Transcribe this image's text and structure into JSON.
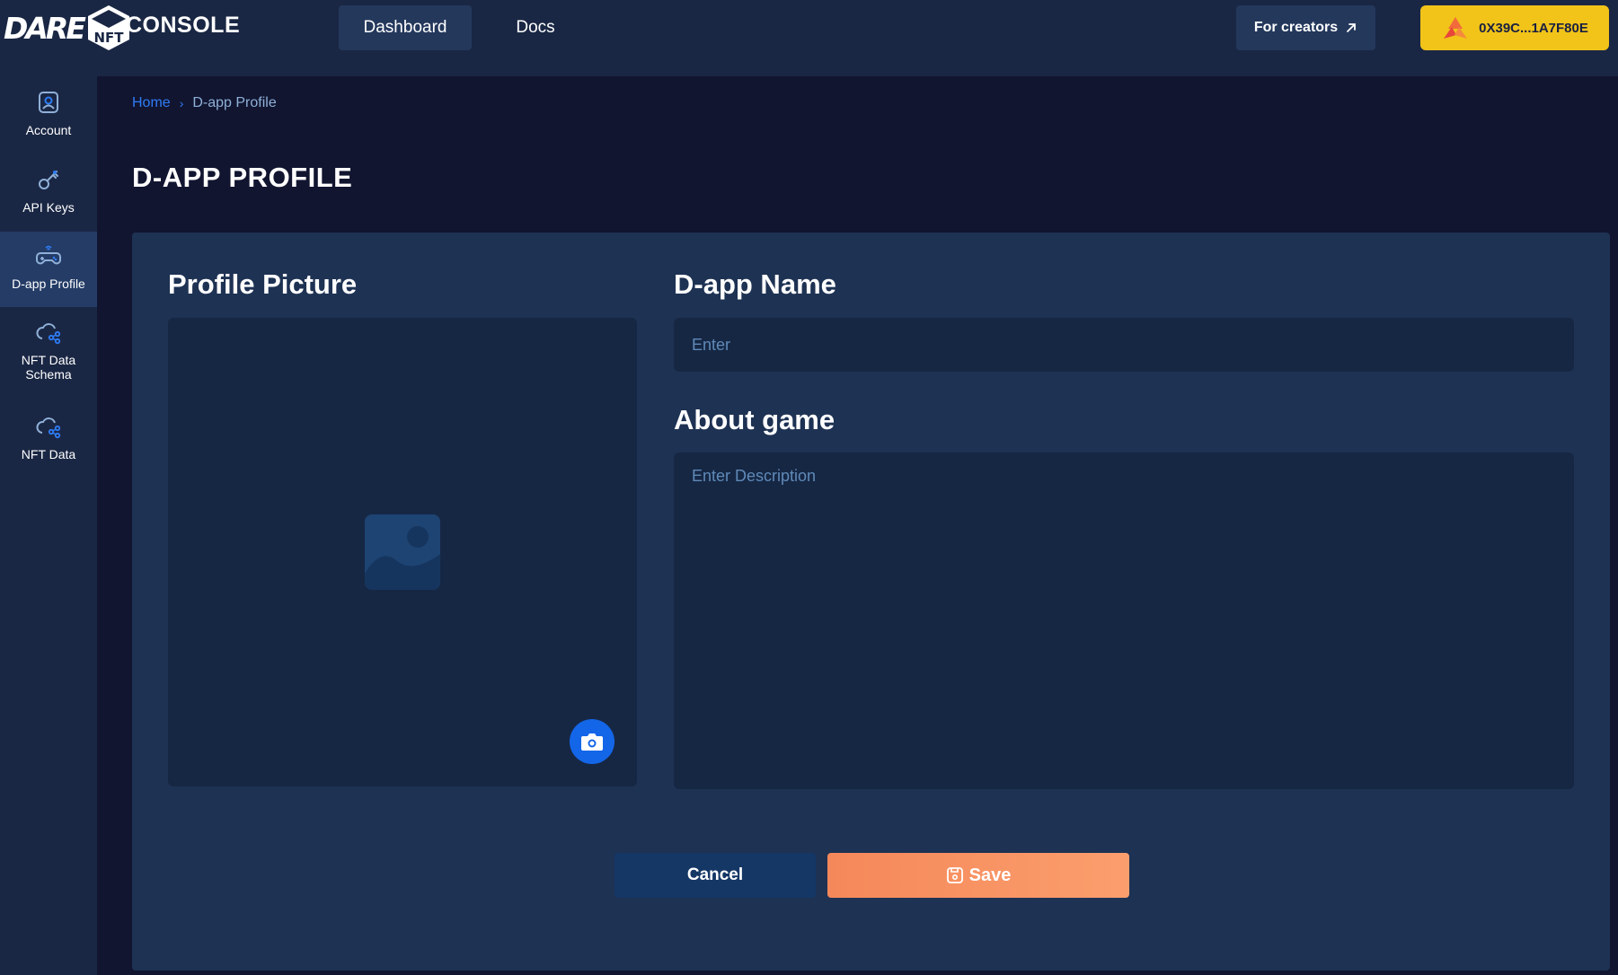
{
  "header": {
    "logo_text": "DARE",
    "logo_cube_text": "NFT",
    "console_title": "CONSOLE",
    "nav": [
      {
        "label": "Dashboard",
        "active": true
      },
      {
        "label": "Docs",
        "active": false
      }
    ],
    "creators_label": "For creators",
    "creators_icon": "external-link-arrow-icon",
    "wallet_address": "0X39C...1A7F80E",
    "wallet_icon": "wallet-logo-icon"
  },
  "sidebar": {
    "items": [
      {
        "label": "Account",
        "icon": "account-icon",
        "active": false
      },
      {
        "label": "API Keys",
        "icon": "key-icon",
        "active": false
      },
      {
        "label": "D-app Profile",
        "icon": "gamepad-icon",
        "active": true
      },
      {
        "label": "NFT Data Schema",
        "icon": "cloud-share-icon",
        "active": false
      },
      {
        "label": "NFT Data",
        "icon": "cloud-share-icon",
        "active": false
      }
    ]
  },
  "breadcrumb": {
    "home": "Home",
    "separator": "›",
    "current": "D-app Profile"
  },
  "page_title": "D-APP PROFILE",
  "form": {
    "profile_picture_heading": "Profile Picture",
    "dapp_name_heading": "D-app Name",
    "dapp_name_value": "",
    "dapp_name_placeholder": "Enter",
    "about_heading": "About game",
    "about_value": "",
    "about_placeholder": "Enter Description",
    "cancel_label": "Cancel",
    "save_label": "Save"
  },
  "colors": {
    "background": "#111530",
    "topbar": "#1a2744",
    "panel": "#1e3253",
    "field": "#162744",
    "link_blue": "#2f7cf6",
    "wallet_yellow": "#f2c419",
    "save_orange": "#f5885a",
    "cancel_navy": "#143766",
    "camera_blue": "#1466e8"
  }
}
